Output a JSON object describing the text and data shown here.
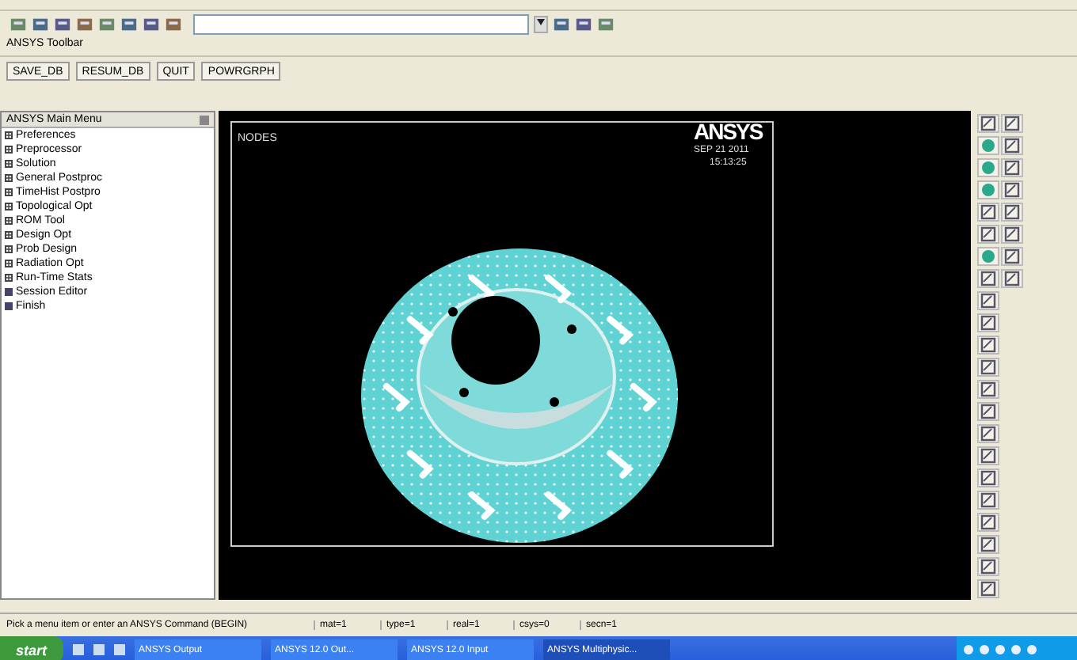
{
  "toolbar_label": "ANSYS Toolbar",
  "toolbar_buttons": [
    "SAVE_DB",
    "RESUM_DB",
    "QUIT",
    "POWRGRPH"
  ],
  "main_menu": {
    "title": "ANSYS Main Menu",
    "items": [
      {
        "label": "Preferences",
        "kind": "folder"
      },
      {
        "label": "Preprocessor",
        "kind": "folder"
      },
      {
        "label": "Solution",
        "kind": "folder"
      },
      {
        "label": "General Postproc",
        "kind": "folder"
      },
      {
        "label": "TimeHist Postpro",
        "kind": "folder"
      },
      {
        "label": "Topological Opt",
        "kind": "folder"
      },
      {
        "label": "ROM Tool",
        "kind": "folder"
      },
      {
        "label": "Design Opt",
        "kind": "folder"
      },
      {
        "label": "Prob Design",
        "kind": "folder"
      },
      {
        "label": "Radiation Opt",
        "kind": "folder"
      },
      {
        "label": "Run-Time Stats",
        "kind": "folder"
      },
      {
        "label": "Session Editor",
        "kind": "command"
      },
      {
        "label": "Finish",
        "kind": "command"
      }
    ]
  },
  "graphics": {
    "title": "NODES",
    "logo": "ANSYS",
    "date": "SEP 21 2011",
    "time": "15:13:25"
  },
  "status_bar": {
    "prompt": "Pick a menu item or enter an ANSYS Command (BEGIN)",
    "fields": [
      "mat=1",
      "type=1",
      "real=1",
      "csys=0",
      "secn=1"
    ]
  },
  "taskbar": {
    "start": "start",
    "tasks": [
      {
        "label": "ANSYS Output",
        "selected": false
      },
      {
        "label": "ANSYS 12.0 Out...",
        "selected": false
      },
      {
        "label": "ANSYS 12.0 Input",
        "selected": false
      },
      {
        "label": "ANSYS Multiphysic...",
        "selected": true
      }
    ]
  }
}
